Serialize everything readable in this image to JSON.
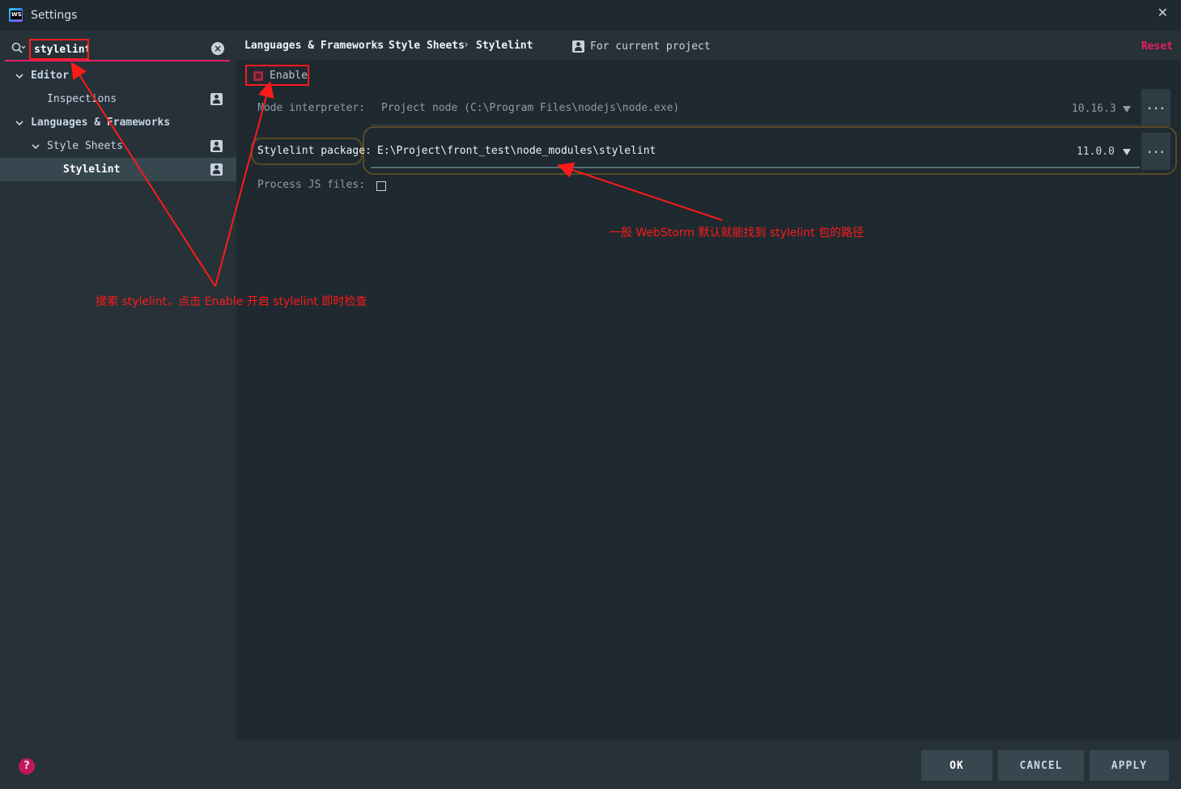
{
  "window": {
    "title": "Settings"
  },
  "search": {
    "value": "stylelint"
  },
  "tree": {
    "items": [
      {
        "label": "Editor"
      },
      {
        "label": "Inspections"
      },
      {
        "label": "Languages & Frameworks"
      },
      {
        "label": "Style Sheets"
      },
      {
        "label": "Stylelint"
      }
    ]
  },
  "breadcrumb": {
    "items": [
      "Languages & Frameworks",
      "Style Sheets",
      "Stylelint"
    ],
    "separator": "›"
  },
  "scope": {
    "label": "For current project"
  },
  "reset": {
    "label": "Reset"
  },
  "settings": {
    "enable_label": "Enable",
    "node_interpreter": {
      "label": "Node interpreter:",
      "prefix": "Project",
      "value": "node (C:\\Program Files\\nodejs\\node.exe)",
      "version": "10.16.3"
    },
    "stylelint_package": {
      "label": "Stylelint package:",
      "value": "E:\\Project\\front_test\\node_modules\\stylelint",
      "version": "11.0.0"
    },
    "process_js": {
      "label": "Process JS files:"
    },
    "dots_label": "..."
  },
  "buttons": {
    "ok": "OK",
    "cancel": "CANCEL",
    "apply": "APPLY"
  },
  "annotations": {
    "search_note": "搜索 stylelint，点击 Enable 开启 stylelint 即时检查",
    "package_note": "一般 WebStorm 默认就能找到 stylelint 包的路径"
  },
  "colors": {
    "accent": "#e91e63",
    "annotation": "#ff1a1a",
    "background": "#263238",
    "panel": "#1f2930"
  }
}
